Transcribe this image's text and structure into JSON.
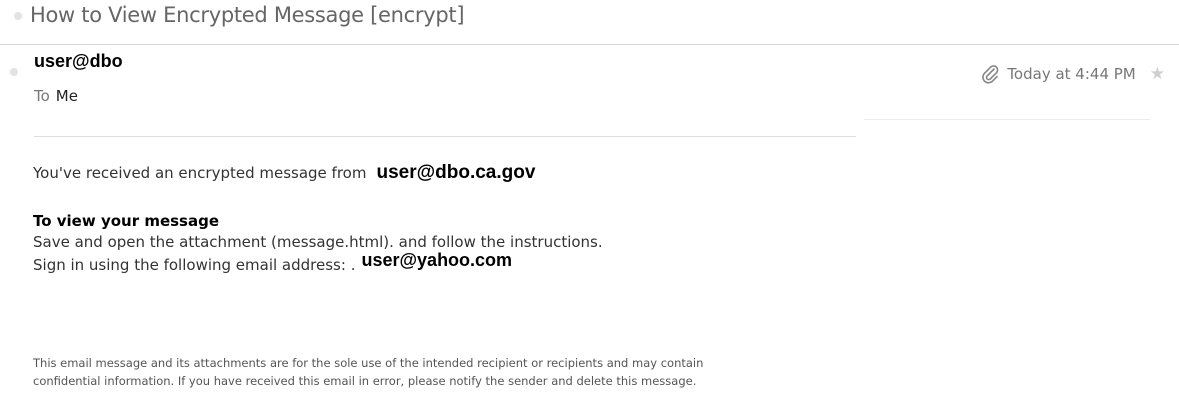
{
  "header": {
    "subject": "How to View Encrypted Message [encrypt]"
  },
  "message": {
    "sender": "user@dbo",
    "to_label": "To",
    "to_value": "Me",
    "timestamp": "Today at 4:44 PM",
    "icons": {
      "attachment": "paperclip-icon",
      "star": "star-icon"
    }
  },
  "body": {
    "intro": "You've received an encrypted message from",
    "intro_email": "user@dbo.ca.gov",
    "heading": "To view your message",
    "line1": "Save and open the attachment (message.html). and follow the instructions.",
    "line2": "Sign in using the following email address: .",
    "line2_email": "user@yahoo.com",
    "disclaimer_line1": "This email message and its attachments are for the sole use of the intended recipient or recipients and may contain",
    "disclaimer_line2": "confidential information. If you have received this email in error, please notify the sender and delete this message."
  }
}
